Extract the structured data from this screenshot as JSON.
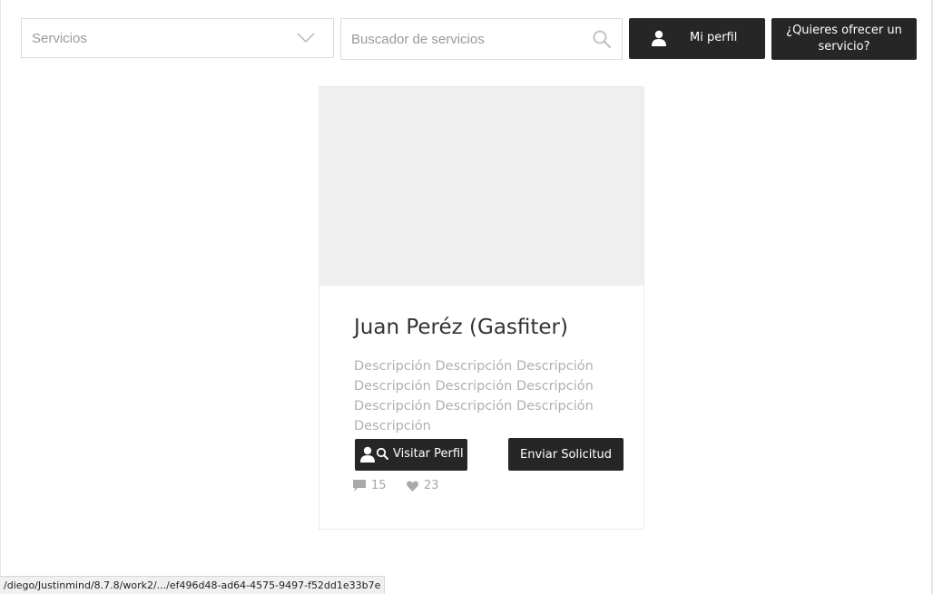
{
  "toolbar": {
    "service_select": {
      "selected": "Servicios"
    },
    "search": {
      "placeholder": "Buscador de servicios",
      "value": ""
    },
    "profile_button": {
      "label": "Mi perfil",
      "icon": "user-icon"
    },
    "offer_button": {
      "label": "¿Quieres ofrecer un servicio?"
    }
  },
  "card": {
    "name": "Juan Peréz (Gasfiter)",
    "description": "Descripción Descripción Descripción Descripción Descripción Descripción Descripción Descripción Descripción Descripción",
    "visit_button": {
      "label": "Visitar Perfil",
      "icon": "user-search-icon"
    },
    "send_button": {
      "label": "Enviar Solicitud"
    },
    "stats": {
      "comments": {
        "icon": "comment-icon",
        "count": "15"
      },
      "likes": {
        "icon": "heart-icon",
        "count": "23"
      }
    }
  },
  "status_bar": {
    "url": "/diego/Justinmind/8.7.8/work2/.../ef496d48-ad64-4575-9497-f52dd1e33b7e"
  },
  "colors": {
    "dark_button": "#262626",
    "placeholder_gray": "#efefef",
    "muted_text": "#b0b0b0"
  }
}
